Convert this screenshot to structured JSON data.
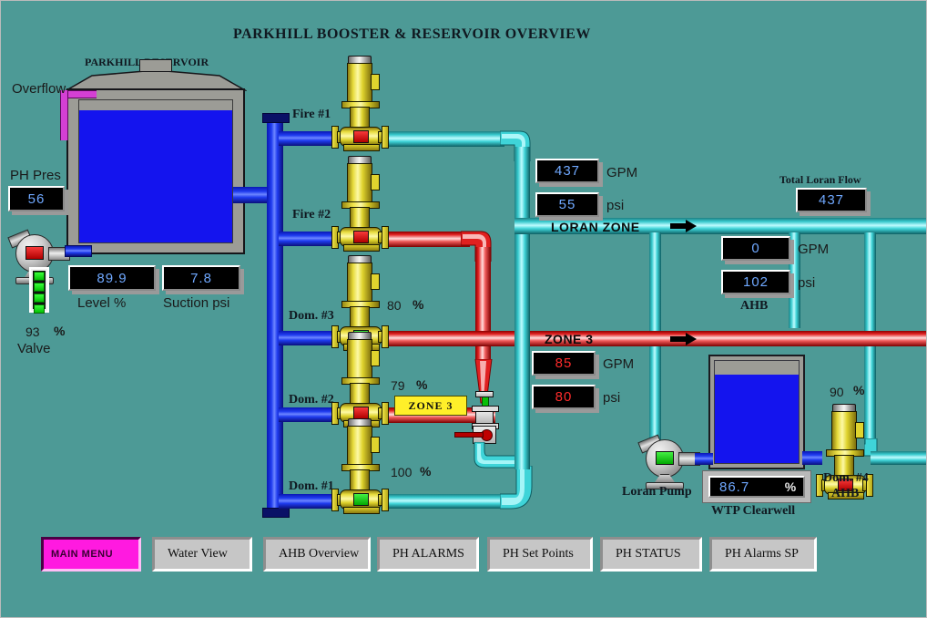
{
  "page": {
    "title": "PARKHILL BOOSTER & RESERVOIR OVERVIEW",
    "background_color": "#4d9a96"
  },
  "reservoir": {
    "label": "PARKHILL RESERVOIR",
    "overflow_label": "Overflow",
    "level_value": "89.9",
    "level_label": "Level   %",
    "suction_value": "7.8",
    "suction_label": "Suction psi",
    "ph_pres_label": "PH Pres",
    "ph_pres_value": "56",
    "valve_value": "93",
    "valve_percent_symbol": "%",
    "valve_label": "Valve"
  },
  "pumps": [
    {
      "name": "Fire #1",
      "state": "off",
      "indicator_color": "#f83a3a",
      "speed": null,
      "speed_symbol": null
    },
    {
      "name": "Fire #2",
      "state": "off",
      "indicator_color": "#f83a3a",
      "speed": null,
      "speed_symbol": null
    },
    {
      "name": "Dom. #3",
      "state": "on",
      "indicator_color": "#44f044",
      "speed": "80",
      "speed_symbol": "%"
    },
    {
      "name": "Dom. #2",
      "state": "off",
      "indicator_color": "#f83a3a",
      "speed": "79",
      "speed_symbol": "%"
    },
    {
      "name": "Dom. #1",
      "state": "on",
      "indicator_color": "#44f044",
      "speed": "100",
      "speed_symbol": "%"
    }
  ],
  "loran_zone": {
    "pipe_label": "LORAN ZONE",
    "gpm_value": "437",
    "gpm_label": "GPM",
    "psi_value": "55",
    "psi_label": "psi",
    "total_flow_label": "Total Loran Flow",
    "total_flow_value": "437"
  },
  "ahb": {
    "gpm_value": "0",
    "gpm_label": "GPM",
    "psi_value": "102",
    "psi_label": "psi",
    "label": "AHB"
  },
  "zone3": {
    "pipe_label": "ZONE 3",
    "tag_label": "ZONE 3",
    "gpm_value": "85",
    "gpm_label": "GPM",
    "psi_value": "80",
    "psi_label": "psi"
  },
  "clearwell": {
    "label": "WTP Clearwell",
    "level_value": "86.7",
    "percent_symbol": "%"
  },
  "loran_pump": {
    "label": "Loran Pump",
    "state": "on",
    "indicator_color": "#44f044"
  },
  "dom4_ahb": {
    "label_line1": "Dom. #4",
    "label_line2": "AHB",
    "speed": "90",
    "speed_symbol": "%",
    "state": "off",
    "indicator_color": "#f83a3a"
  },
  "nav_buttons": [
    {
      "label": "MAIN MENU",
      "active": true
    },
    {
      "label": "Water View",
      "active": false
    },
    {
      "label": "AHB Overview",
      "active": false
    },
    {
      "label": "PH ALARMS",
      "active": false
    },
    {
      "label": "PH Set Points",
      "active": false
    },
    {
      "label": "PH STATUS",
      "active": false
    },
    {
      "label": "PH Alarms SP",
      "active": false
    }
  ]
}
